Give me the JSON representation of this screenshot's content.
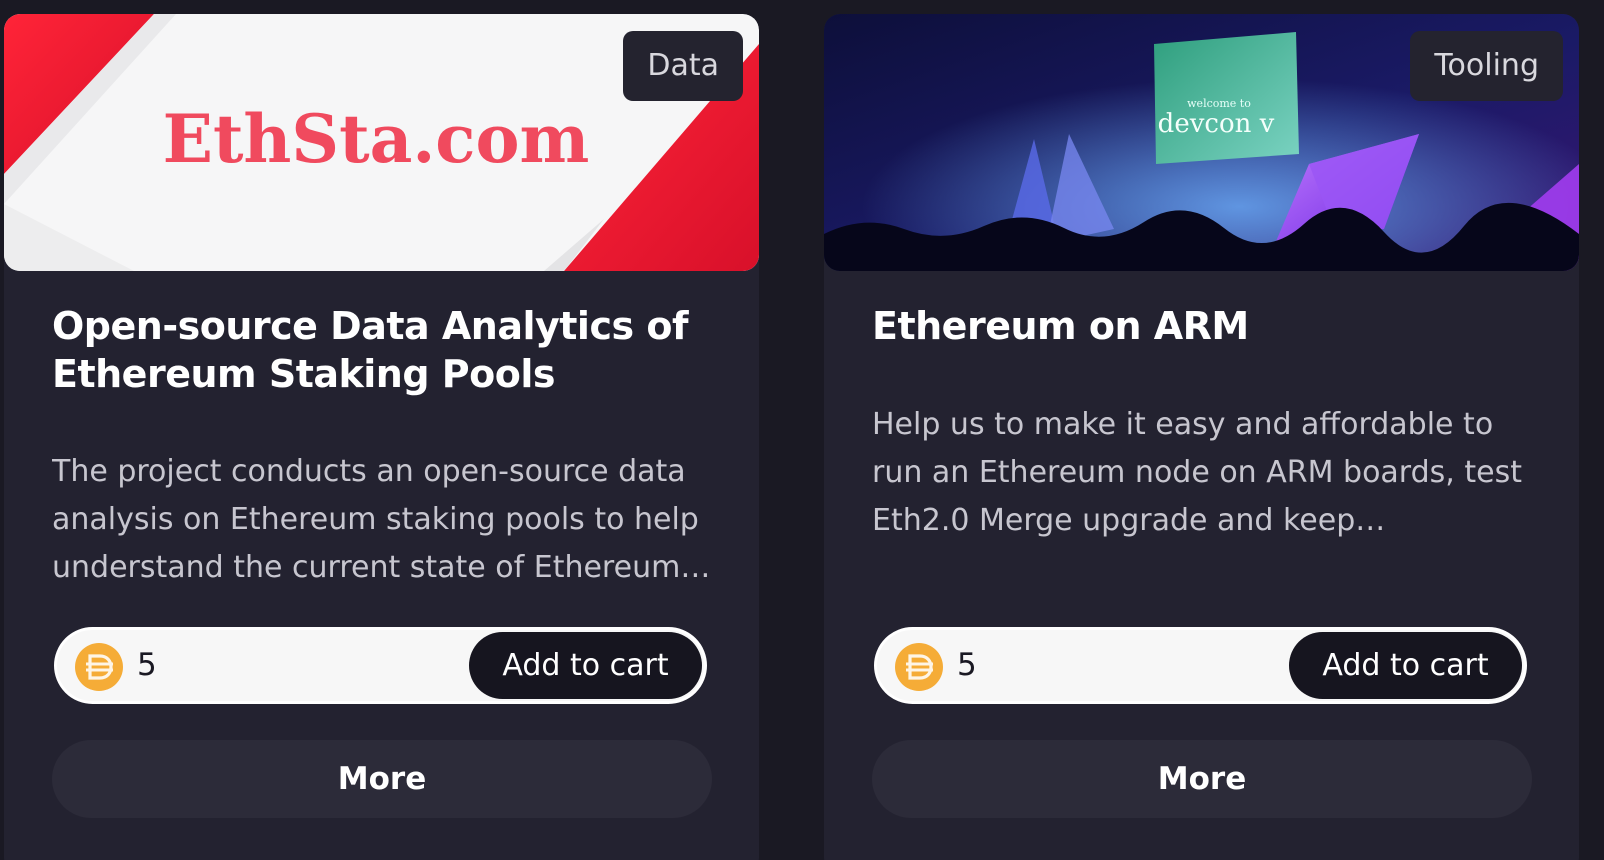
{
  "cards": [
    {
      "category": "Data",
      "banner_text": "EthSta.com",
      "title": "Open-source Data Analytics of Ethereum Staking Pools",
      "description": "The project conducts an open-source data analysis on Ethereum staking pools to help understand the current state of Ethereum staking pools and their trends.",
      "price": "5",
      "add_to_cart_label": "Add to cart",
      "more_label": "More"
    },
    {
      "category": "Tooling",
      "banner_text": "devcon v",
      "banner_subtext": "welcome to",
      "title": "Ethereum on ARM",
      "description": "Help us to make it easy and affordable to run an Ethereum node on ARM boards, test Eth2.0 Merge upgrade and keep…",
      "price": "5",
      "add_to_cart_label": "Add to cart",
      "more_label": "More"
    }
  ],
  "colors": {
    "page_bg": "#1a1923",
    "card_bg": "#232230",
    "coin": "#f5ac37",
    "brand_red": "#f0203a"
  },
  "icons": {
    "coin": "dai-coin-icon"
  }
}
